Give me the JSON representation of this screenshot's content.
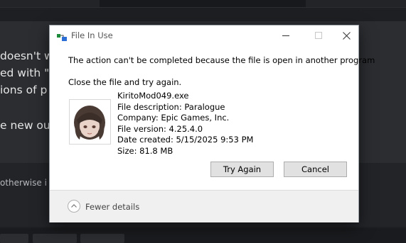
{
  "background": {
    "line1": "doesn't w                                                              e and u",
    "line2": "ed with \"                                                              nsConfi",
    "line3": "ions of p",
    "line4": "e new out",
    "small_text": "otherwise i"
  },
  "dialog": {
    "title": "File In Use",
    "message": "The action can't be completed because the file is open in another program",
    "instruction": "Close the file and try again.",
    "file": {
      "name": "KiritoMod049.exe",
      "description": "File description: Paralogue",
      "company": "Company: Epic Games, Inc.",
      "version": "File version: 4.25.4.0",
      "date_created": "Date created: 5/15/2025 9:53 PM",
      "size": "Size: 81.8 MB"
    },
    "buttons": {
      "try_again": "Try Again",
      "cancel": "Cancel"
    },
    "footer": {
      "fewer_details": "Fewer details"
    }
  },
  "icons": {
    "app": "file-in-use-icon",
    "minimize": "minimize-icon",
    "maximize": "maximize-icon",
    "close": "close-icon",
    "fewer_details": "chevron-up-icon",
    "thumbnail": "file-thumbnail"
  },
  "colors": {
    "dialog_bg": "#ffffff",
    "button_bg": "#e1e1e1",
    "footer_bg": "#f0f0f0",
    "page_bg": "#2b2d31"
  }
}
